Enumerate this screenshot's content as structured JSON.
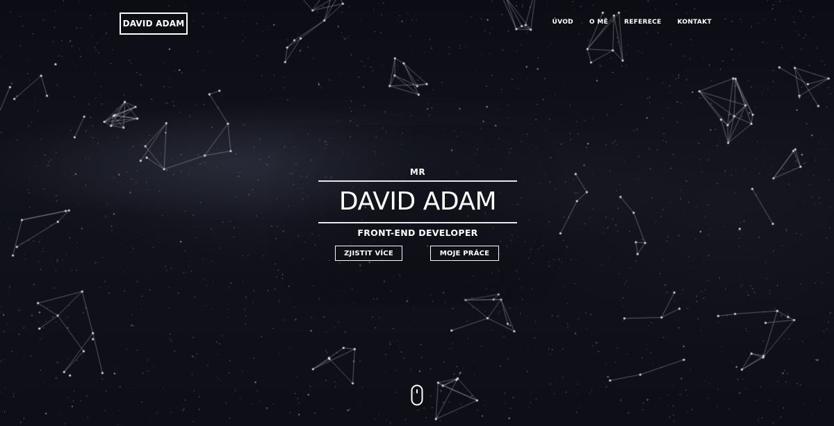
{
  "header": {
    "logo": "DAVID ADAM",
    "nav": [
      {
        "label": "ÚVOD"
      },
      {
        "label": "O MĚ"
      },
      {
        "label": "REFERECE"
      },
      {
        "label": "KONTAKT"
      }
    ]
  },
  "hero": {
    "prefix": "MR",
    "name": "DAVID ADAM",
    "role": "FRONT-END DEVELOPER",
    "buttons": {
      "more": "ZJISTIT VÍCE",
      "work": "MOJE PRÁCE"
    },
    "scroll_icon": "mouse-scroll-icon",
    "background": "starfield-constellations"
  },
  "colors": {
    "background": "#0b0c12",
    "text": "#ffffff",
    "accent": "#e8e8ec"
  }
}
